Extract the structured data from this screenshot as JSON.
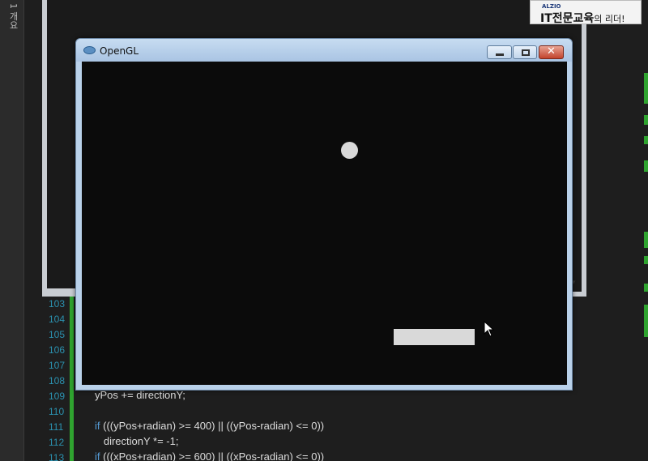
{
  "sidebar": {
    "vertical_tab_label": "1 개요"
  },
  "banner": {
    "small_text": "ALZIO",
    "main_text": "IT전문교육",
    "suffix_text": "의 리더!"
  },
  "editor": {
    "line_numbers": [
      "103",
      "104",
      "105",
      "106",
      "107",
      "108",
      "109",
      "110",
      "111",
      "112",
      "113"
    ],
    "code_lines": [
      {
        "line": "109",
        "text": "yPos += directionY;"
      },
      {
        "line": "111",
        "keyword": "if",
        "text": " (((yPos+radian) >= 400) || ((yPos-radian) <= 0))"
      },
      {
        "line": "112",
        "text": "   directionY *= -1;"
      },
      {
        "line": "113",
        "keyword": "if",
        "text": " (((xPos+radian) >= 600) || ((xPos-radian) <= 0))"
      }
    ]
  },
  "window": {
    "title": "OpenGL",
    "close_glyph": "✕",
    "icon": "opengl-app-icon",
    "buttons": [
      "minimize-icon",
      "maximize-icon",
      "close-icon"
    ]
  },
  "colors": {
    "change_bar": "#2fa32f",
    "line_number": "#2b91af",
    "keyword": "#569cd6",
    "canvas": "#0b0b0b",
    "shape": "#d9d9d9"
  }
}
